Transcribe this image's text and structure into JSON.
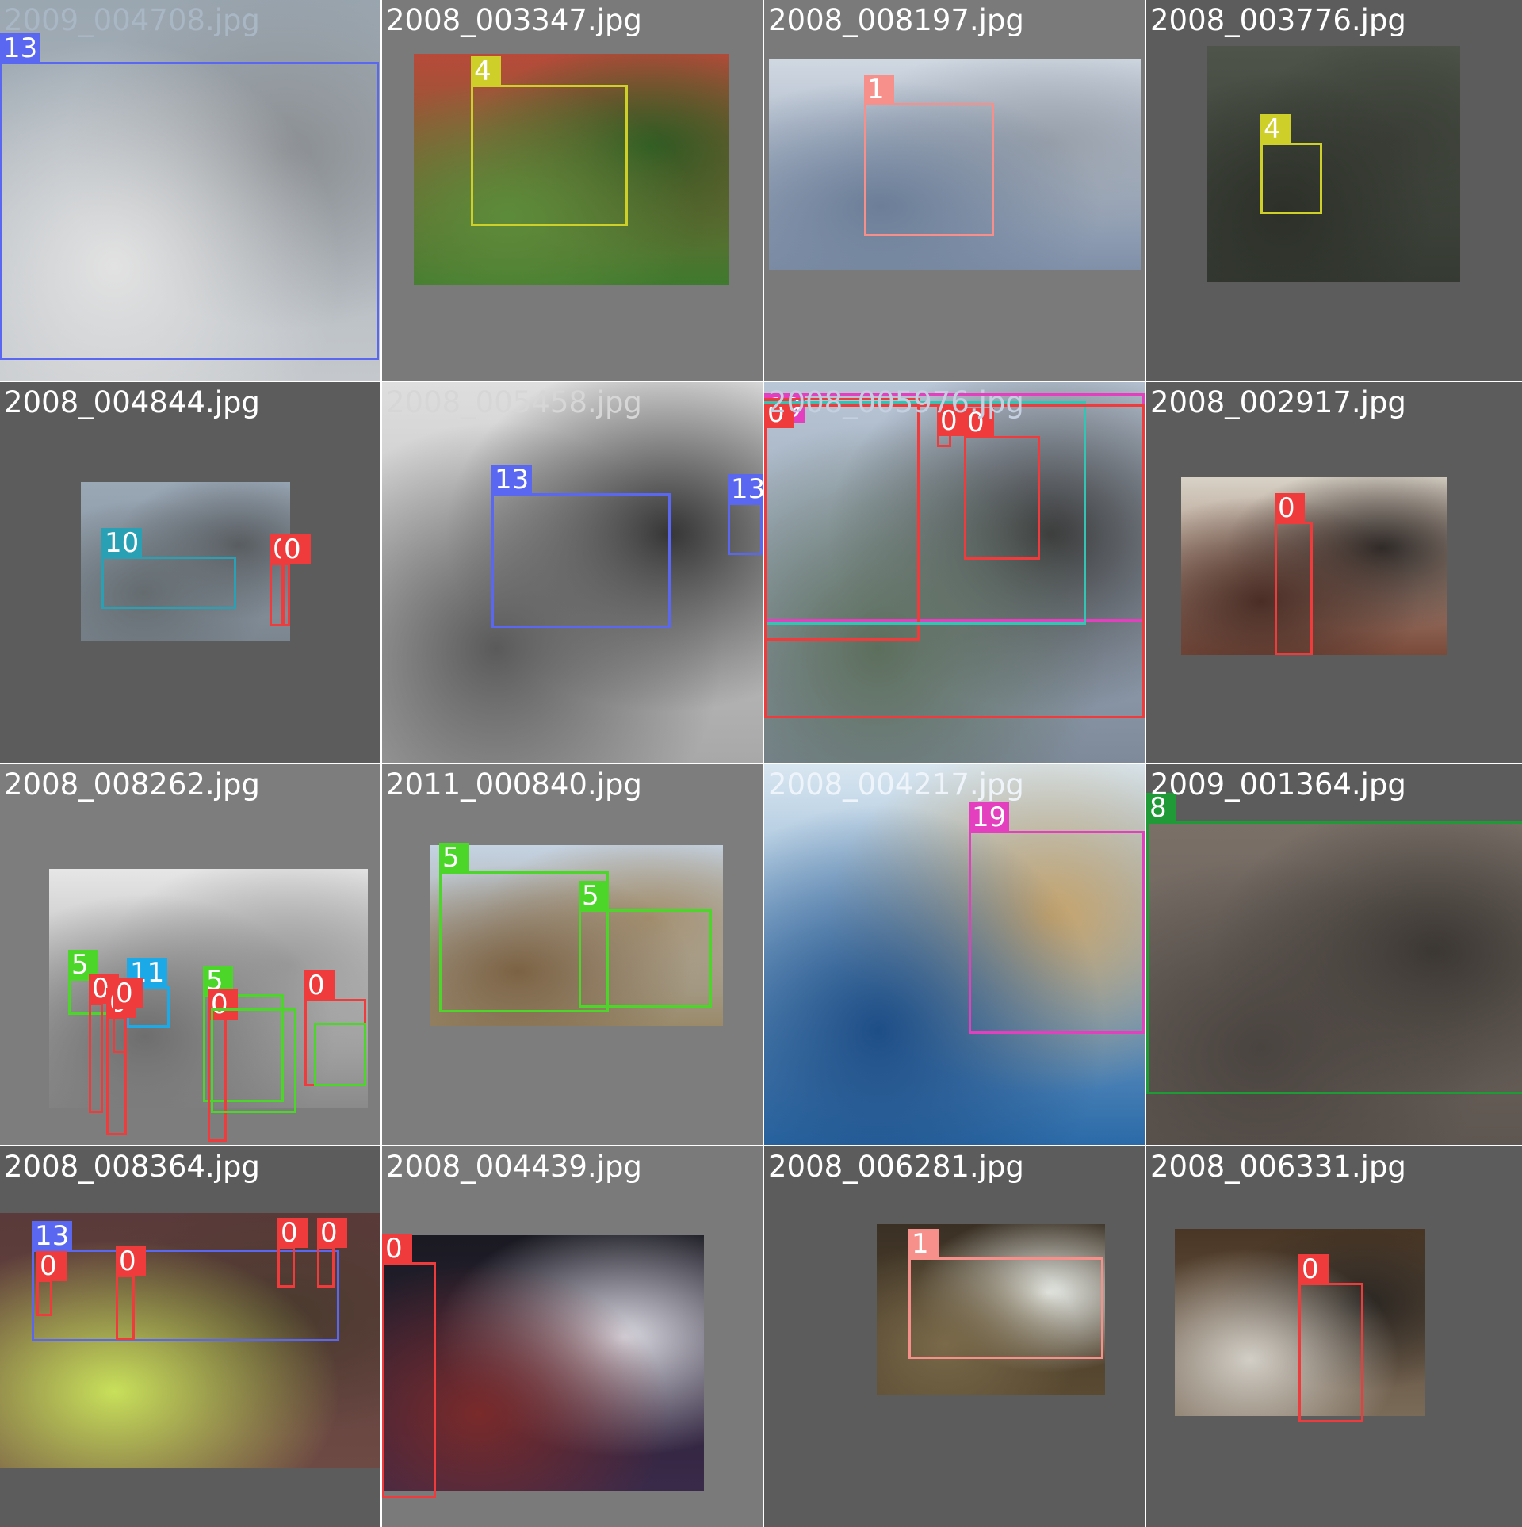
{
  "colors": {
    "0": "#ef3b3b",
    "1": "#f7908a",
    "4": "#cfcf2a",
    "5": "#4dd62a",
    "8": "#1f9a36",
    "10": "#2aa0b4",
    "11": "#1ca9e8",
    "13": "#5a67f0",
    "19": "#e33fbf",
    "teal": "#33c4b4"
  },
  "tiles": [
    {
      "filename": "2009_004708.jpg",
      "name_color": "#a9b6c4",
      "background": "#7d7d7d",
      "photo_colors": [
        "#9aa6b0",
        "#c4c8cc",
        "#e2e2e2",
        "#8a8e92"
      ],
      "boxes": [
        {
          "label": "13",
          "color_key": "13"
        }
      ]
    },
    {
      "filename": "2008_003347.jpg",
      "name_color": "#ffffff",
      "background": "#7a7a7a",
      "photo_colors": [
        "#b84a3a",
        "#3e7a2e",
        "#5c8c3a",
        "#2e5a22"
      ],
      "boxes": [
        {
          "label": "4",
          "color_key": "4"
        }
      ]
    },
    {
      "filename": "2008_008197.jpg",
      "name_color": "#ffffff",
      "background": "#7a7a7a",
      "photo_colors": [
        "#d0d8e2",
        "#8090a8",
        "#6c7e98",
        "#98a0aa"
      ],
      "boxes": [
        {
          "label": "1",
          "color_key": "1"
        }
      ]
    },
    {
      "filename": "2008_003776.jpg",
      "name_color": "#ffffff",
      "background": "#5c5c5c",
      "photo_colors": [
        "#4e544a",
        "#353a32",
        "#2c3028",
        "#3a3e36"
      ],
      "boxes": [
        {
          "label": "4",
          "color_key": "4"
        }
      ]
    },
    {
      "filename": "2008_004844.jpg",
      "name_color": "#ffffff",
      "background": "#5c5c5c",
      "photo_colors": [
        "#9aa8b6",
        "#7c8690",
        "#646c70",
        "#585c60"
      ],
      "boxes": [
        {
          "label": "10",
          "color_key": "10"
        },
        {
          "label": "0",
          "color_key": "0"
        },
        {
          "label": "0",
          "color_key": "0"
        }
      ]
    },
    {
      "filename": "2008_005458.jpg",
      "name_color": "#d6d6d6",
      "background": "#6a6a6a",
      "photo_colors": [
        "#dedede",
        "#a8a8a8",
        "#5a5a5a",
        "#333333"
      ],
      "boxes": [
        {
          "label": "13",
          "color_key": "13"
        },
        {
          "label": "13",
          "color_key": "13"
        }
      ]
    },
    {
      "filename": "2008_005976.jpg",
      "name_color": "#c4cfe0",
      "background": "#5c5c5c",
      "photo_colors": [
        "#b9c6d6",
        "#7e8a9a",
        "#5c6e5c",
        "#3a3a3a"
      ],
      "boxes": [
        {
          "label": "19",
          "color_key": "19"
        },
        {
          "label": "0",
          "color_key": "0"
        },
        {
          "label": "0",
          "color_key": "0"
        },
        {
          "label": "0",
          "color_key": "0"
        },
        {
          "label": "",
          "color_key": "teal"
        },
        {
          "label": "",
          "color_key": "0"
        }
      ]
    },
    {
      "filename": "2008_002917.jpg",
      "name_color": "#ffffff",
      "background": "#5c5c5c",
      "photo_colors": [
        "#d8d2c6",
        "#7a4a3a",
        "#4a2e26",
        "#2e2a28"
      ],
      "boxes": [
        {
          "label": "0",
          "color_key": "0"
        }
      ]
    },
    {
      "filename": "2008_008262.jpg",
      "name_color": "#ffffff",
      "background": "#7d7d7d",
      "photo_colors": [
        "#e6e6e6",
        "#8a8a8a",
        "#6e6e6e",
        "#9c9c9c"
      ],
      "boxes": [
        {
          "label": "5",
          "color_key": "5"
        },
        {
          "label": "0",
          "color_key": "0"
        },
        {
          "label": "11",
          "color_key": "11"
        },
        {
          "label": "0",
          "color_key": "0"
        },
        {
          "label": "0",
          "color_key": "0"
        },
        {
          "label": "5",
          "color_key": "5"
        },
        {
          "label": "0",
          "color_key": "0"
        },
        {
          "label": "",
          "color_key": "5"
        },
        {
          "label": "0",
          "color_key": "0"
        },
        {
          "label": "",
          "color_key": "5"
        }
      ]
    },
    {
      "filename": "2011_000840.jpg",
      "name_color": "#ffffff",
      "background": "#7d7d7d",
      "photo_colors": [
        "#c4d2e2",
        "#9a8a6a",
        "#7c6244",
        "#a49070"
      ],
      "boxes": [
        {
          "label": "5",
          "color_key": "5"
        },
        {
          "label": "5",
          "color_key": "5"
        }
      ]
    },
    {
      "filename": "2008_004217.jpg",
      "name_color": "#eef4fa",
      "background": "#7a7a7a",
      "photo_colors": [
        "#d8e6f0",
        "#2a6aa8",
        "#1e4e86",
        "#c8a46a"
      ],
      "boxes": [
        {
          "label": "19",
          "color_key": "19"
        }
      ]
    },
    {
      "filename": "2009_001364.jpg",
      "name_color": "#ffffff",
      "background": "#5c5c5c",
      "photo_colors": [
        "#7a7068",
        "#5e5650",
        "#4a4440",
        "#3a3632"
      ],
      "boxes": [
        {
          "label": "8",
          "color_key": "8"
        }
      ]
    },
    {
      "filename": "2008_008364.jpg",
      "name_color": "#ffffff",
      "background": "#5c5c5c",
      "photo_colors": [
        "#5a3a3a",
        "#6e4a44",
        "#c8e05a",
        "#4a3a2e"
      ],
      "boxes": [
        {
          "label": "13",
          "color_key": "13"
        },
        {
          "label": "0",
          "color_key": "0"
        },
        {
          "label": "0",
          "color_key": "0"
        },
        {
          "label": "0",
          "color_key": "0"
        },
        {
          "label": "0",
          "color_key": "0"
        }
      ]
    },
    {
      "filename": "2008_004439.jpg",
      "name_color": "#ffffff",
      "background": "#7a7a7a",
      "photo_colors": [
        "#1a1a22",
        "#3a2a4a",
        "#7a2a2a",
        "#d8d8e0"
      ],
      "boxes": [
        {
          "label": "0",
          "color_key": "0"
        }
      ]
    },
    {
      "filename": "2008_006281.jpg",
      "name_color": "#ffffff",
      "background": "#5c5c5c",
      "photo_colors": [
        "#3a3024",
        "#5a4a32",
        "#7a6a4a",
        "#e8ece8"
      ],
      "boxes": [
        {
          "label": "1",
          "color_key": "1"
        }
      ]
    },
    {
      "filename": "2008_006331.jpg",
      "name_color": "#ffffff",
      "background": "#5c5c5c",
      "photo_colors": [
        "#4a3624",
        "#7a6a58",
        "#d2cec6",
        "#2a2622"
      ],
      "boxes": [
        {
          "label": "0",
          "color_key": "0"
        }
      ]
    }
  ]
}
